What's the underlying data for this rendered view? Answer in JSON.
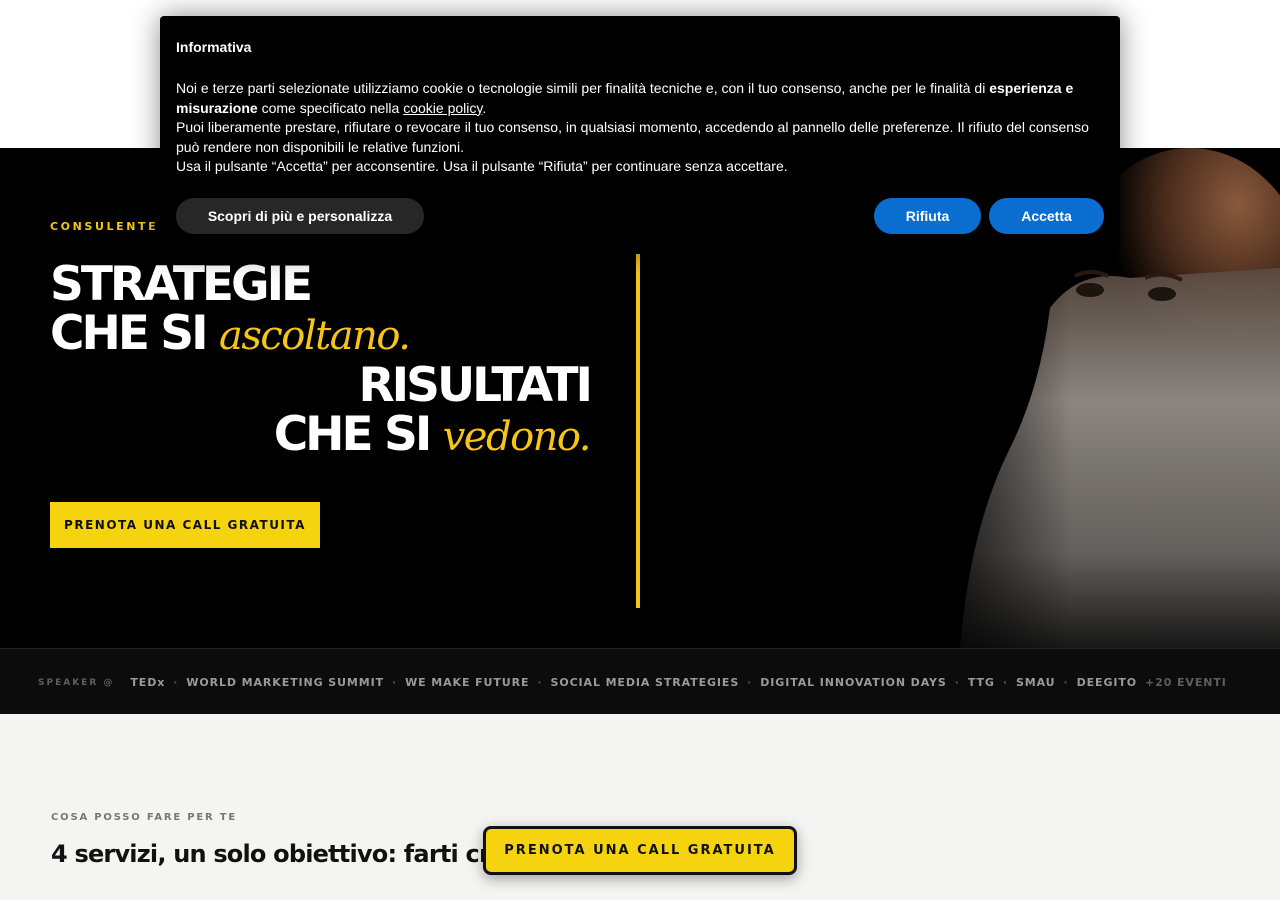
{
  "colors": {
    "accent_yellow": "#f5c518",
    "cta_yellow": "#f5d40f",
    "consent_blue": "#0a6ed1",
    "hero_bg": "#000000",
    "speaker_bar_bg": "#0c0c0c",
    "section_bg": "#f4f4f2"
  },
  "cookie": {
    "title": "Informativa",
    "p1_start": "Noi e terze parti selezionate utilizziamo cookie o tecnologie simili per finalità tecniche e, con il tuo consenso, anche per le finalità di ",
    "p1_bold": "esperienza e misurazione",
    "p1_mid": " come specificato nella ",
    "p1_link": "cookie policy",
    "p1_end": ".",
    "p2": "Puoi liberamente prestare, rifiutare o revocare il tuo consenso, in qualsiasi momento, accedendo al pannello delle preferenze. Il rifiuto del consenso può rendere non disponibili le relative funzioni.",
    "p3": "Usa il pulsante “Accetta” per acconsentire. Usa il pulsante “Rifiuta” per continuare senza accettare.",
    "customize_label": "Scopri di più e personalizza",
    "reject_label": "Rifiuta",
    "accept_label": "Accetta"
  },
  "hero": {
    "kicker": "CONSULENTE",
    "line1": "STRATEGIE",
    "line2_plain": "CHE SI ",
    "line2_accent": "ascoltano.",
    "line3": "RISULTATI",
    "line4_plain": "CHE SI ",
    "line4_accent": "vedono.",
    "cta_label": "PRENOTA UNA CALL GRATUITA"
  },
  "speaker_bar": {
    "lead": "SPEAKER @",
    "events": [
      "TEDx",
      "WORLD MARKETING SUMMIT",
      "WE MAKE FUTURE",
      "SOCIAL MEDIA STRATEGIES",
      "DIGITAL INNOVATION DAYS",
      "TTG",
      "SMAU",
      "DEEGITO"
    ],
    "more": "+20 EVENTI"
  },
  "services": {
    "eyebrow": "COSA POSSO FARE PER TE",
    "title": "4 servizi, un solo obiettivo: farti cresc"
  },
  "sticky_cta": {
    "label": "PRENOTA UNA CALL GRATUITA"
  }
}
